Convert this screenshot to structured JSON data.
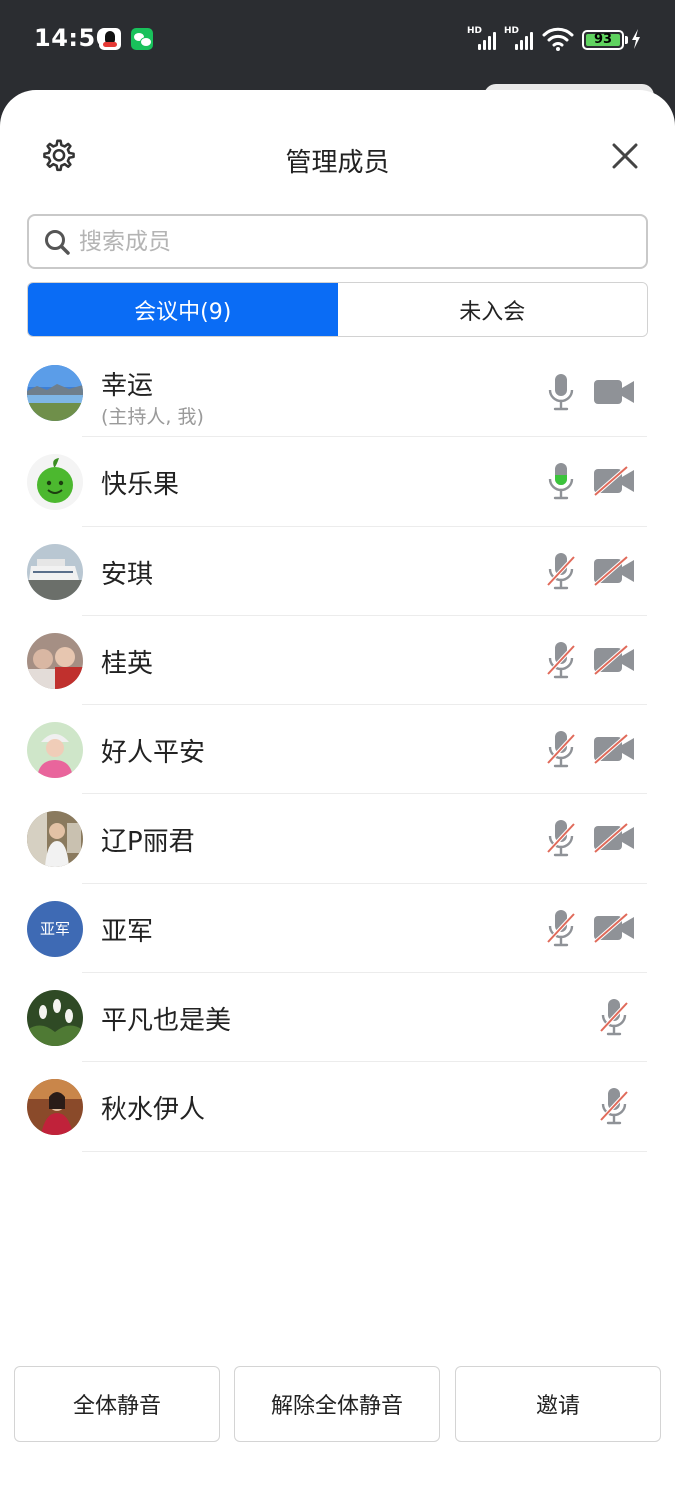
{
  "status_bar": {
    "time": "14:50",
    "battery": "93",
    "notification_icons": [
      "qq-icon",
      "wechat-icon"
    ],
    "system_icons": [
      "signal-hd-icon",
      "signal-hd-icon",
      "wifi-icon",
      "battery-icon",
      "charging-icon"
    ]
  },
  "header": {
    "title": "管理成员",
    "settings_icon": "gear-icon",
    "close_icon": "close-icon"
  },
  "search": {
    "placeholder": "搜索成员",
    "value": ""
  },
  "tabs": [
    {
      "label": "会议中(9)",
      "active": true
    },
    {
      "label": "未入会",
      "active": false
    }
  ],
  "members": [
    {
      "name": "幸运",
      "sub": "(主持人, 我)",
      "avatar": "landscape",
      "mic": "on",
      "camera": "on"
    },
    {
      "name": "快乐果",
      "sub": "",
      "avatar": "green-apple",
      "mic": "speaking",
      "camera": "off"
    },
    {
      "name": "安琪",
      "sub": "",
      "avatar": "ship",
      "mic": "off",
      "camera": "off"
    },
    {
      "name": "桂英",
      "sub": "",
      "avatar": "portrait-1",
      "mic": "off",
      "camera": "off"
    },
    {
      "name": "好人平安",
      "sub": "",
      "avatar": "portrait-2",
      "mic": "off",
      "camera": "off"
    },
    {
      "name": "辽P丽君",
      "sub": "",
      "avatar": "portrait-3",
      "mic": "off",
      "camera": "off"
    },
    {
      "name": "亚军",
      "sub": "",
      "avatar_text": "亚军",
      "mic": "off",
      "camera": "off"
    },
    {
      "name": "平凡也是美",
      "sub": "",
      "avatar": "flowers",
      "mic": "off",
      "camera": "none"
    },
    {
      "name": "秋水伊人",
      "sub": "",
      "avatar": "portrait-4",
      "mic": "off",
      "camera": "none"
    }
  ],
  "actions": {
    "mute_all": "全体静音",
    "unmute_all": "解除全体静音",
    "invite": "邀请"
  },
  "colors": {
    "accent": "#0a6cf5",
    "speaking": "#3cc43c",
    "muted_slash": "#e06a5a",
    "icon_gray": "#8f9297"
  }
}
